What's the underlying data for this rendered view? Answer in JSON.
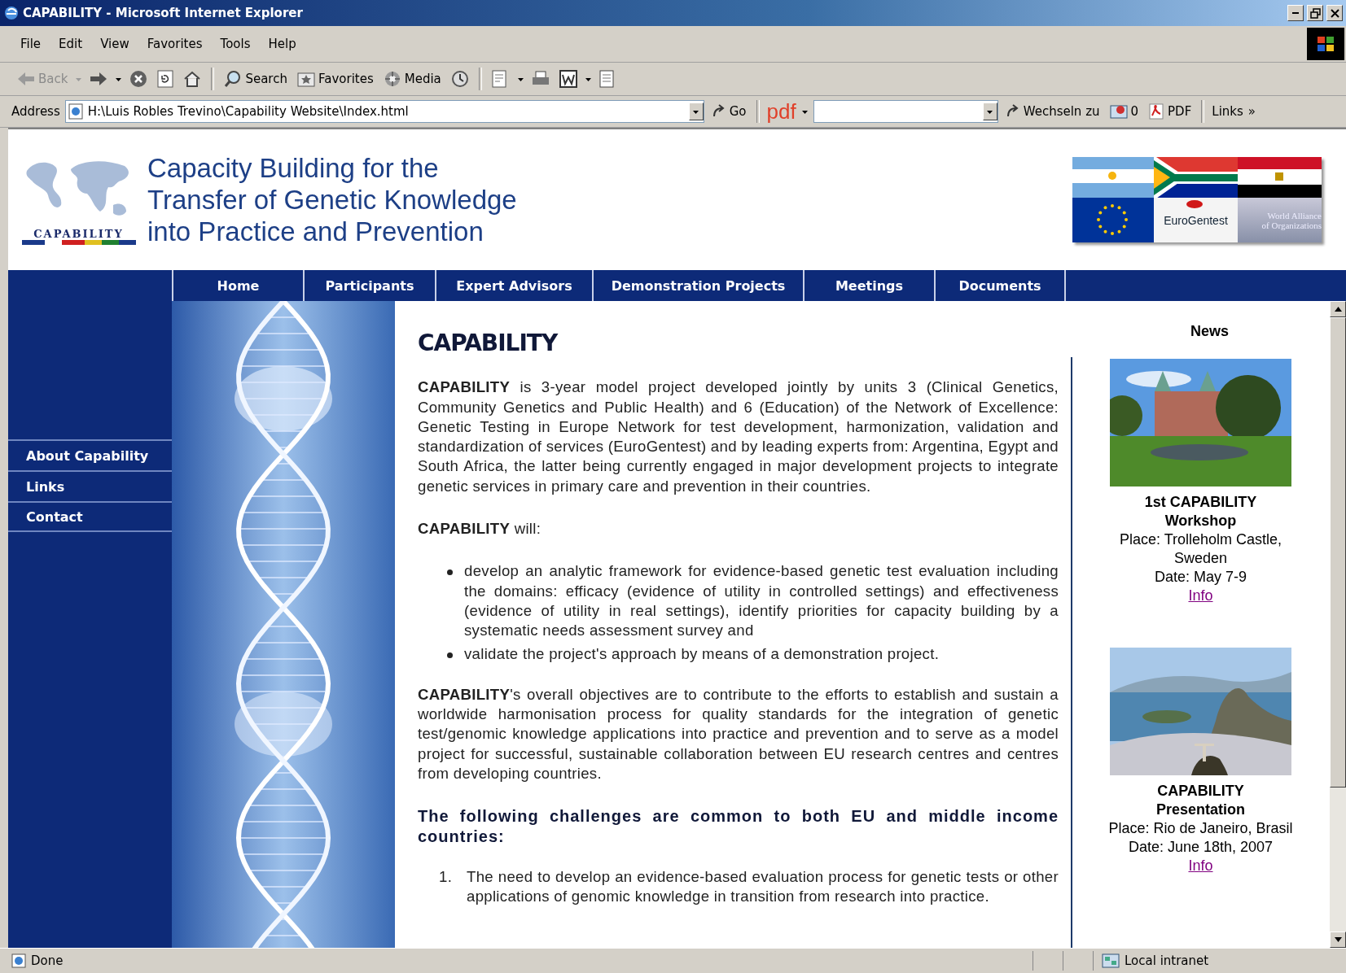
{
  "window": {
    "title": "CAPABILITY - Microsoft Internet Explorer"
  },
  "menu_bar": [
    "File",
    "Edit",
    "View",
    "Favorites",
    "Tools",
    "Help"
  ],
  "toolbar": {
    "back": {
      "label": "Back",
      "disabled": true
    },
    "search": "Search",
    "favorites": "Favorites",
    "media": "Media"
  },
  "address_bar": {
    "label": "Address",
    "value": "H:\\Luis Robles Trevino\\Capability Website\\Index.html",
    "go": "Go"
  },
  "pdf_bar": {
    "label": "pdf",
    "switch_to": "Wechseln zu",
    "mail_count": "0",
    "pdf": "PDF",
    "links": "Links",
    "more": "»"
  },
  "header": {
    "logo_text": "CAPABILITY",
    "title_lines": [
      "Capacity Building for the",
      "Transfer of Genetic Knowledge",
      "into Practice and Prevention"
    ],
    "banner": {
      "logo": "EuroGentest",
      "alliance": [
        "World Alliance",
        "of Organizations"
      ]
    }
  },
  "nav": [
    "Home",
    "Participants",
    "Expert Advisors",
    "Demonstration Projects",
    "Meetings",
    "Documents"
  ],
  "sidebar": [
    "About Capability",
    "Links",
    "Contact"
  ],
  "content": {
    "heading": "CAPABILITY",
    "blocks": [
      {
        "kind": "paragraph",
        "text": "**CAPABILITY** is 3-year model project developed jointly by units 3 (Clinical Genetics, Community Genetics and Public Health) and 6 (Education) of the Network of Excellence: Genetic Testing in Europe Network for test development, harmonization, validation and standardization of services (EuroGentest) and by leading experts from: Argentina, Egypt and South Africa, the latter being currently engaged in major development projects to integrate genetic services in primary care and prevention in their countries."
      },
      {
        "kind": "paragraph",
        "text": "**CAPABILITY** will:"
      },
      {
        "kind": "bullets",
        "items": [
          "develop an analytic framework for evidence-based genetic test evaluation including the domains: efficacy (evidence of utility in controlled settings) and effectiveness (evidence of utility in real settings), identify priorities for capacity building by a systematic needs assessment survey and",
          "validate the project's approach by means of a demonstration project."
        ]
      },
      {
        "kind": "paragraph",
        "text": "**CAPABILITY**'s overall objectives are to contribute to the efforts to establish and sustain a worldwide harmonisation process for quality standards for the integration of genetic test/genomic knowledge applications into practice and prevention and to serve as a model project for successful, sustainable collaboration between EU research centres and centres from developing countries."
      },
      {
        "kind": "subheading",
        "text": "The following challenges are common to both EU and middle income countries:"
      },
      {
        "kind": "numbered",
        "items": [
          {
            "number": "1.",
            "text": "The need to develop an evidence-based evaluation process for genetic tests or other applications of genomic knowledge in transition from research into practice."
          }
        ]
      }
    ]
  },
  "news": {
    "title": "News",
    "items": [
      {
        "title": "1st CAPABILITY Workshop",
        "place": "Place: Trolleholm Castle, Sweden",
        "date": "Date: May 7-9",
        "link": "Info"
      },
      {
        "title": "CAPABILITY Presentation",
        "place": "Place: Rio de Janeiro, Brasil",
        "date": "Date: June 18th, 2007",
        "link": "Info"
      }
    ]
  },
  "status_bar": {
    "text": "Done",
    "zone": "Local intranet"
  }
}
